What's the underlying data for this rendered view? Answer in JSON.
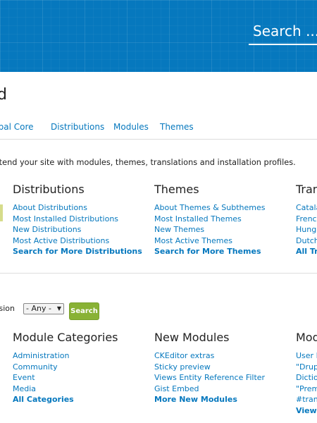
{
  "header": {
    "search_placeholder": "Search ..."
  },
  "page": {
    "title_fragment": "d"
  },
  "tabs": [
    {
      "label": "upal Core"
    },
    {
      "label": "Distributions"
    },
    {
      "label": "Modules"
    },
    {
      "label": "Themes"
    }
  ],
  "intro_text": "xtend your site with modules, themes, translations and installation profiles.",
  "sections_top": [
    {
      "heading": "Distributions",
      "links": [
        "About Distributions",
        "Most Installed Distributions",
        "New Distributions",
        "Most Active Distributions"
      ],
      "more": "Search for More Distributions"
    },
    {
      "heading": "Themes",
      "links": [
        "About Themes & Subthemes",
        "Most Installed Themes",
        "New Themes",
        "Most Active Themes"
      ],
      "more": "Search for More Themes"
    },
    {
      "heading": "Tran",
      "links": [
        "Catala",
        "Frenc",
        "Hung",
        "Dutch"
      ],
      "more": "All Tr"
    }
  ],
  "filter": {
    "label": "rsion",
    "selected": "- Any -",
    "button": "Search"
  },
  "sections_bottom": [
    {
      "heading": "Module Categories",
      "links": [
        "Administration",
        "Community",
        "Event",
        "Media"
      ],
      "more": "All Categories"
    },
    {
      "heading": "New Modules",
      "links": [
        "CKEditor extras",
        "Sticky preview",
        "Views Entity Reference Filter",
        "Gist Embed"
      ],
      "more": "More New Modules"
    },
    {
      "heading": "Mod",
      "links": [
        "User R",
        "\"Drup",
        "Dictio",
        "\"Prem",
        "#tran"
      ],
      "more": "View"
    }
  ]
}
